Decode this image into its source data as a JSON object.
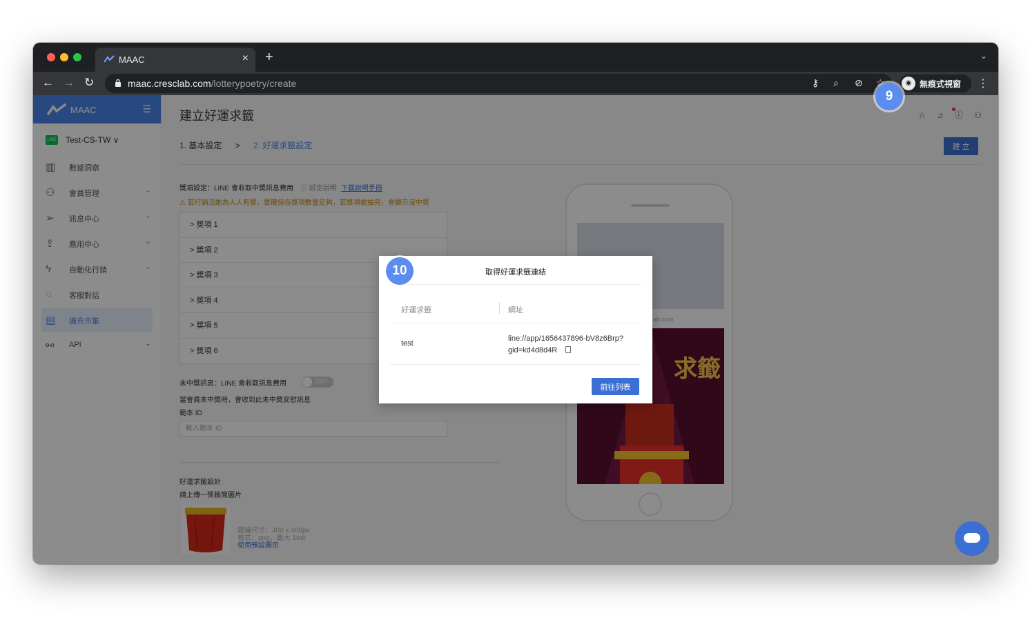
{
  "browser": {
    "tab_title": "MAAC",
    "url_host": "maac.cresclab.com",
    "url_path": "/lotterypoetry/create",
    "incognito_label": "無痕式視窗"
  },
  "sidebar": {
    "brand": "MAAC",
    "account": "Test-CS-TW",
    "line_badge": "LINE",
    "items": [
      {
        "label": "數據洞察",
        "icon": "chart-icon"
      },
      {
        "label": "會員管理",
        "icon": "user-icon"
      },
      {
        "label": "訊息中心",
        "icon": "send-icon"
      },
      {
        "label": "應用中心",
        "icon": "rocket-icon"
      },
      {
        "label": "自動化行銷",
        "icon": "bolt-icon"
      },
      {
        "label": "客服對話",
        "icon": "chat-icon"
      },
      {
        "label": "擴充市集",
        "icon": "store-icon"
      },
      {
        "label": "API",
        "icon": "api-icon"
      }
    ]
  },
  "main": {
    "title": "建立好運求籤",
    "step1": "1. 基本設定",
    "step_sep": ">",
    "step2": "2. 好運求籤設定",
    "create_button": "建 立",
    "prize_setting_title": "獎項設定：LINE 會收取中獎訊息費用",
    "setting_info": "設定說明",
    "download_manual": "下載說明手冊",
    "warning": "若行銷活動為人人有獎，要確保各獎項數量足夠，若獎項被抽完，會顯示沒中獎",
    "prizes": [
      "獎項 1",
      "獎項 2",
      "獎項 3",
      "獎項 4",
      "獎項 5",
      "獎項 6"
    ],
    "no_win_title": "未中獎訊息：LINE 會收取訊息費用",
    "toggle_label": "OFF",
    "no_win_desc": "當會員未中獎時，會收到此未中獎安慰訊息",
    "template_id_label": "範本 ID",
    "template_id_placeholder": "輸入範本 ID",
    "design_title": "好運求籤設計",
    "design_upload": "請上傳一張籤筒圖片",
    "hint_size": "建議尺寸：400 x 400px",
    "hint_format": "格式：png，最大 1mb",
    "hint_default": "使用預設圖示",
    "phone_url": "ab.com"
  },
  "modal": {
    "title": "取得好運求籤連結",
    "col_name": "好運求籤",
    "col_url": "網址",
    "row_name": "test",
    "row_url": "line://app/1656437896-bV8z6Brp?gid=kd4d8d4R",
    "goto_button": "前往列表"
  },
  "badges": {
    "step9": "9",
    "step10": "10"
  },
  "colors": {
    "accent": "#4a86e8",
    "button": "#3b6fd4",
    "badge": "#5b8def",
    "warning": "#c98a00"
  }
}
